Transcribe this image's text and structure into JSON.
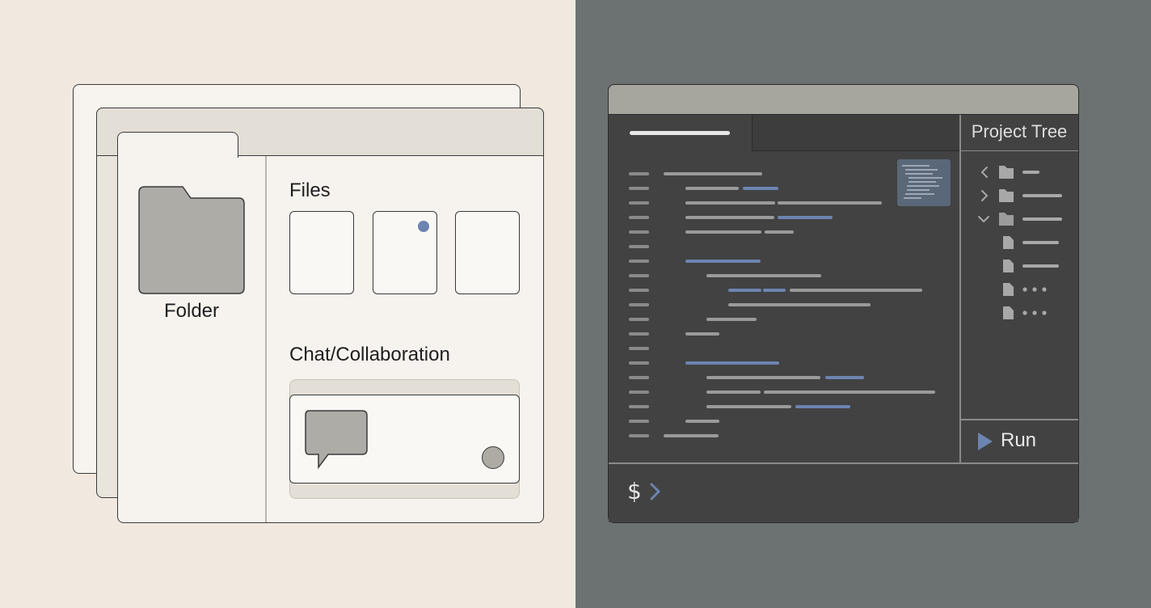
{
  "left": {
    "folder_label": "Folder",
    "files_heading": "Files",
    "chat_heading": "Chat/Collaboration",
    "icons": [
      "folder-icon",
      "chat-bubble-icon",
      "avatar-icon"
    ]
  },
  "right": {
    "tree_title": "Project Tree",
    "tree_items": [
      {
        "kind": "folder",
        "chevron": "left"
      },
      {
        "kind": "folder",
        "chevron": "right"
      },
      {
        "kind": "folder-open",
        "chevron": "down"
      },
      {
        "kind": "file"
      },
      {
        "kind": "file"
      },
      {
        "kind": "file",
        "ellipsis": true
      },
      {
        "kind": "file",
        "ellipsis": true
      }
    ],
    "run_label": "Run",
    "terminal_prompt": "$"
  },
  "colors": {
    "accent": "#6c84b1",
    "left_background": "#f1e9df",
    "right_background": "#6c7171",
    "ide_background": "#424242"
  }
}
